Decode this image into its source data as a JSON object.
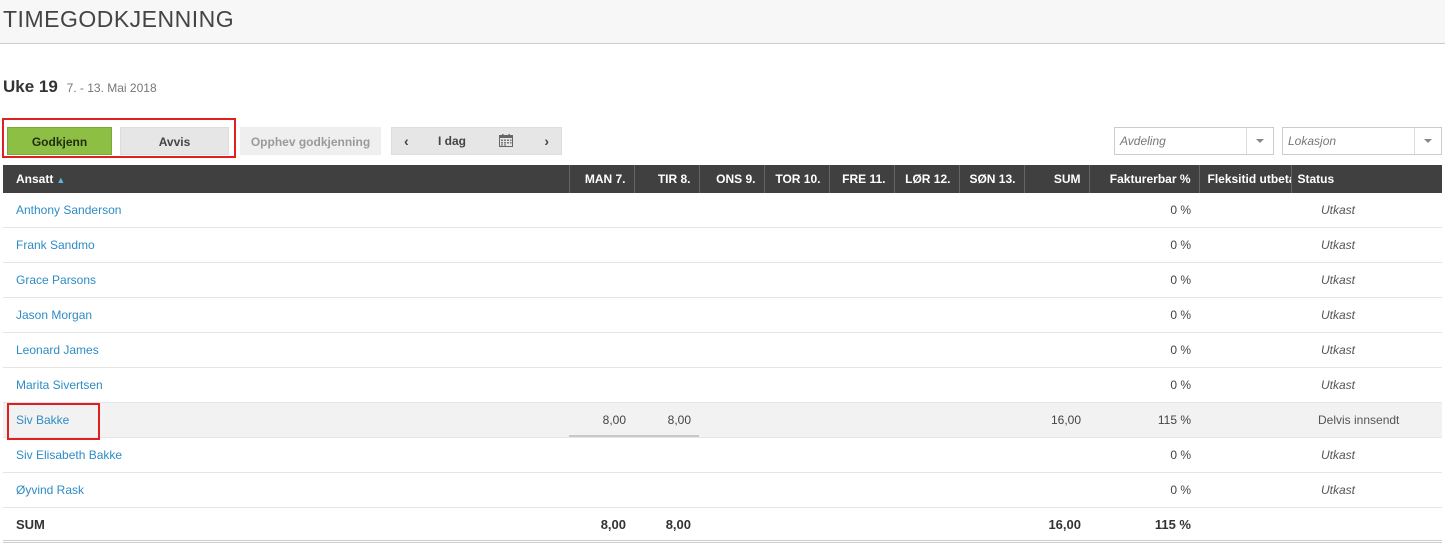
{
  "page": {
    "title": "TIMEGODKJENNING"
  },
  "week": {
    "label": "Uke 19",
    "range": "7. - 13. Mai 2018"
  },
  "toolbar": {
    "approve_label": "Godkjenn",
    "reject_label": "Avvis",
    "unapprove_label": "Opphev godkjenning",
    "prev": "‹",
    "today_label": "I dag",
    "next": "›"
  },
  "filters": {
    "department_placeholder": "Avdeling",
    "location_placeholder": "Lokasjon"
  },
  "table": {
    "headers": {
      "name": "Ansatt",
      "mon": "MAN 7.",
      "tue": "TIR 8.",
      "wed": "ONS 9.",
      "thu": "TOR 10.",
      "fri": "FRE 11.",
      "sat": "LØR 12.",
      "sun": "SØN 13.",
      "sum": "SUM",
      "billable": "Fakturerbar %",
      "flex": "Fleksitid utbetalt",
      "status": "Status"
    },
    "rows": [
      {
        "name": "Anthony Sanderson",
        "mon": "",
        "tue": "",
        "sum": "",
        "billable": "0 %",
        "status": "Utkast"
      },
      {
        "name": "Frank Sandmo",
        "mon": "",
        "tue": "",
        "sum": "",
        "billable": "0 %",
        "status": "Utkast"
      },
      {
        "name": "Grace Parsons",
        "mon": "",
        "tue": "",
        "sum": "",
        "billable": "0 %",
        "status": "Utkast"
      },
      {
        "name": "Jason Morgan",
        "mon": "",
        "tue": "",
        "sum": "",
        "billable": "0 %",
        "status": "Utkast"
      },
      {
        "name": "Leonard James",
        "mon": "",
        "tue": "",
        "sum": "",
        "billable": "0 %",
        "status": "Utkast"
      },
      {
        "name": "Marita Sivertsen",
        "mon": "",
        "tue": "",
        "sum": "",
        "billable": "0 %",
        "status": "Utkast"
      },
      {
        "name": "Siv Bakke",
        "mon": "8,00",
        "tue": "8,00",
        "sum": "16,00",
        "billable": "115 %",
        "status": "Delvis innsendt"
      },
      {
        "name": "Siv Elisabeth Bakke",
        "mon": "",
        "tue": "",
        "sum": "",
        "billable": "0 %",
        "status": "Utkast"
      },
      {
        "name": "Øyvind Rask",
        "mon": "",
        "tue": "",
        "sum": "",
        "billable": "0 %",
        "status": "Utkast"
      }
    ],
    "footer": {
      "label": "SUM",
      "mon": "8,00",
      "tue": "8,00",
      "sum": "16,00",
      "billable": "115 %"
    }
  },
  "colors": {
    "accent_green": "#8dbf45",
    "link_blue": "#2e8cc4",
    "header_dark": "#404040",
    "highlight_red": "#e02020"
  }
}
